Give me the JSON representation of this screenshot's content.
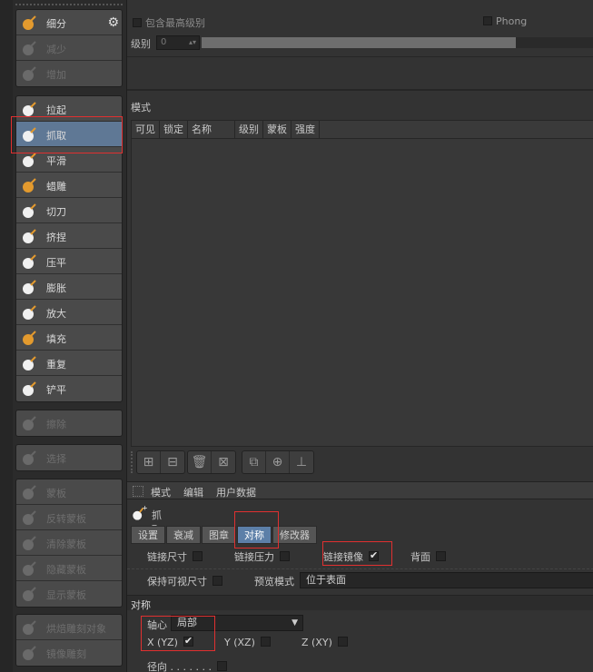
{
  "left_panel": {
    "group1": [
      {
        "label": "细分",
        "icon": "subdivide-icon",
        "dim": false,
        "gear": true
      },
      {
        "label": "减少",
        "icon": "decrease-icon",
        "dim": true
      },
      {
        "label": "增加",
        "icon": "increase-icon",
        "dim": true
      }
    ],
    "group2": [
      {
        "label": "拉起",
        "icon": "pull-brush-icon"
      },
      {
        "label": "抓取",
        "icon": "grab-brush-icon",
        "selected": true
      },
      {
        "label": "平滑",
        "icon": "smooth-brush-icon"
      },
      {
        "label": "蜡雕",
        "icon": "wax-brush-icon"
      },
      {
        "label": "切刀",
        "icon": "knife-brush-icon"
      },
      {
        "label": "挤捏",
        "icon": "pinch-brush-icon"
      },
      {
        "label": "压平",
        "icon": "flatten-brush-icon"
      },
      {
        "label": "膨胀",
        "icon": "inflate-brush-icon"
      },
      {
        "label": "放大",
        "icon": "amplify-brush-icon"
      },
      {
        "label": "填充",
        "icon": "fill-brush-icon"
      },
      {
        "label": "重复",
        "icon": "repeat-brush-icon"
      },
      {
        "label": "铲平",
        "icon": "scrape-brush-icon"
      }
    ],
    "group3": [
      {
        "label": "擦除",
        "icon": "erase-icon",
        "dim": true
      }
    ],
    "group4": [
      {
        "label": "选择",
        "icon": "select-icon",
        "dim": true
      }
    ],
    "group5": [
      {
        "label": "蒙板",
        "icon": "mask-icon",
        "dim": true
      },
      {
        "label": "反转蒙板",
        "icon": "invert-mask-icon",
        "dim": true
      },
      {
        "label": "清除蒙板",
        "icon": "clear-mask-icon",
        "dim": true
      },
      {
        "label": "隐藏蒙板",
        "icon": "hide-mask-icon",
        "dim": true
      },
      {
        "label": "显示蒙板",
        "icon": "show-mask-icon",
        "dim": true
      }
    ],
    "group6": [
      {
        "label": "烘焙雕刻对象",
        "icon": "bake-sculpt-icon",
        "dim": true
      },
      {
        "label": "镜像雕刻",
        "icon": "mirror-sculpt-icon",
        "dim": true
      }
    ]
  },
  "top": {
    "include_max_level": "包含最高级别",
    "phong": "Phong",
    "level_label": "级别",
    "level_value": "0",
    "level_fraction": 0.8
  },
  "layers": {
    "mode_label": "模式",
    "columns": [
      "可见",
      "锁定",
      "名称",
      "级别",
      "蒙板",
      "强度"
    ]
  },
  "attributes": {
    "menu": [
      "模式",
      "编辑",
      "用户数据"
    ],
    "object_name": "抓取",
    "tabs": [
      "设置",
      "衰减",
      "图章",
      "对称",
      "修改器"
    ],
    "active_tab": "对称",
    "link_size": "链接尺寸",
    "link_pressure": "链接压力",
    "link_mirror": "链接镜像",
    "back_face": "背面",
    "keep_visible_size": "保持可视尺寸",
    "preview_mode_label": "预览模式",
    "preview_mode_value": "位于表面",
    "symmetry_header": "对称",
    "axis_label": "轴心",
    "axis_value": "局部",
    "x_label": "X (YZ)",
    "y_label": "Y (XZ)",
    "z_label": "Z (XY)",
    "radial_label": "径向 . . . . . . ."
  }
}
